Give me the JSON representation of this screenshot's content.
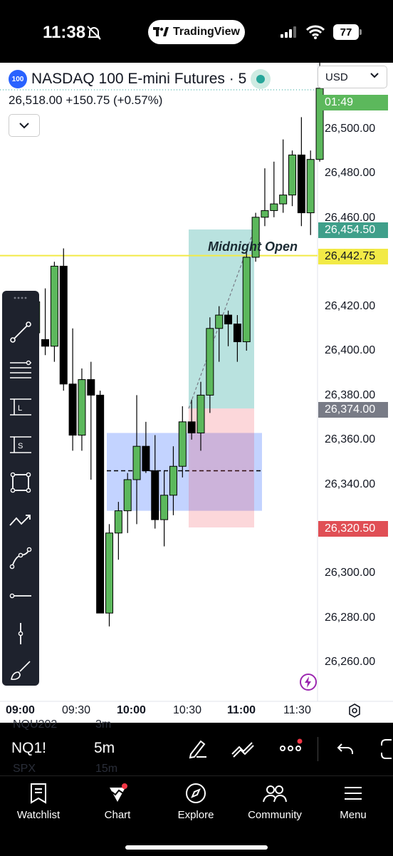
{
  "status_bar": {
    "time": "11:38",
    "app_pill": "TradingView",
    "battery": "77"
  },
  "chart_header": {
    "symbol_badge": "100",
    "title": "NASDAQ 100 E-mini Futures · 5",
    "quote": "26,518.00  +150.75 (+0.57%)",
    "currency": "USD"
  },
  "price_axis": {
    "ticks": [
      "26,500.00",
      "26,480.00",
      "26,460.00",
      "26,420.00",
      "26,400.00",
      "26,380.00",
      "26,360.00",
      "26,340.00",
      "26,300.00",
      "26,280.00",
      "26,260.00"
    ]
  },
  "price_tags": {
    "countdown": "01:49",
    "target": "26,454.50",
    "midnight_open": "26,442.75",
    "entry": "26,374.00",
    "stop": "26,320.50"
  },
  "annotations": {
    "midnight_open_label": "Midnight Open"
  },
  "time_axis": {
    "labels": [
      "09:00",
      "09:30",
      "10:00",
      "10:30",
      "11:00",
      "11:30"
    ]
  },
  "colors": {
    "up": "#5cb85c",
    "down": "#000000",
    "midnight_line": "#f2ea46",
    "target_tag": "#3f9f8a",
    "stop_tag": "#e04f55",
    "entry_tag": "#787b86",
    "countdown_tag": "#5cb85c"
  },
  "bottom_bar": {
    "symbol": "NQ1!",
    "interval": "5m",
    "ghost_symbols": [
      "NQU202",
      "SPX"
    ],
    "ghost_intervals": [
      "3m",
      "15m"
    ]
  },
  "nav": {
    "items": [
      {
        "label": "Watchlist",
        "icon": "watchlist-icon"
      },
      {
        "label": "Chart",
        "icon": "chart-icon"
      },
      {
        "label": "Explore",
        "icon": "compass-icon"
      },
      {
        "label": "Community",
        "icon": "community-icon"
      },
      {
        "label": "Menu",
        "icon": "menu-icon"
      }
    ]
  },
  "chart_data": {
    "type": "candlestick",
    "title": "NASDAQ 100 E-mini Futures · 5",
    "interval": "5m",
    "ylim": [
      26250,
      26525
    ],
    "candles": [
      {
        "o": 26420,
        "h": 26425,
        "l": 26408,
        "c": 26412
      },
      {
        "o": 26410,
        "h": 26418,
        "l": 26402,
        "c": 26405
      },
      {
        "o": 26408,
        "h": 26425,
        "l": 26400,
        "c": 26422
      },
      {
        "o": 26405,
        "h": 26428,
        "l": 26398,
        "c": 26402
      },
      {
        "o": 26402,
        "h": 26440,
        "l": 26395,
        "c": 26438
      },
      {
        "o": 26438,
        "h": 26446,
        "l": 26382,
        "c": 26385
      },
      {
        "o": 26385,
        "h": 26410,
        "l": 26355,
        "c": 26362
      },
      {
        "o": 26362,
        "h": 26392,
        "l": 26355,
        "c": 26387
      },
      {
        "o": 26387,
        "h": 26395,
        "l": 26342,
        "c": 26380
      },
      {
        "o": 26380,
        "h": 26382,
        "l": 26290,
        "c": 26282
      },
      {
        "o": 26282,
        "h": 26322,
        "l": 26276,
        "c": 26318
      },
      {
        "o": 26318,
        "h": 26332,
        "l": 26306,
        "c": 26328
      },
      {
        "o": 26328,
        "h": 26345,
        "l": 26318,
        "c": 26342
      },
      {
        "o": 26342,
        "h": 26380,
        "l": 26322,
        "c": 26357
      },
      {
        "o": 26357,
        "h": 26368,
        "l": 26345,
        "c": 26346
      },
      {
        "o": 26346,
        "h": 26362,
        "l": 26320,
        "c": 26324
      },
      {
        "o": 26324,
        "h": 26346,
        "l": 26312,
        "c": 26335
      },
      {
        "o": 26335,
        "h": 26357,
        "l": 26326,
        "c": 26348
      },
      {
        "o": 26348,
        "h": 26375,
        "l": 26343,
        "c": 26368
      },
      {
        "o": 26368,
        "h": 26378,
        "l": 26360,
        "c": 26363
      },
      {
        "o": 26363,
        "h": 26386,
        "l": 26355,
        "c": 26380
      },
      {
        "o": 26380,
        "h": 26415,
        "l": 26372,
        "c": 26410
      },
      {
        "o": 26410,
        "h": 26420,
        "l": 26395,
        "c": 26416
      },
      {
        "o": 26416,
        "h": 26418,
        "l": 26402,
        "c": 26412
      },
      {
        "o": 26412,
        "h": 26416,
        "l": 26395,
        "c": 26404
      },
      {
        "o": 26404,
        "h": 26446,
        "l": 26400,
        "c": 26442
      },
      {
        "o": 26442,
        "h": 26462,
        "l": 26440,
        "c": 26460
      },
      {
        "o": 26460,
        "h": 26482,
        "l": 26456,
        "c": 26463
      },
      {
        "o": 26463,
        "h": 26485,
        "l": 26460,
        "c": 26466
      },
      {
        "o": 26466,
        "h": 26495,
        "l": 26462,
        "c": 26470
      },
      {
        "o": 26470,
        "h": 26490,
        "l": 26465,
        "c": 26488
      },
      {
        "o": 26488,
        "h": 26505,
        "l": 26456,
        "c": 26462
      },
      {
        "o": 26462,
        "h": 26490,
        "l": 26452,
        "c": 26486
      },
      {
        "o": 26486,
        "h": 26530,
        "l": 26485,
        "c": 26518
      }
    ],
    "midnight_open": 26442.75,
    "long_position": {
      "entry": 26374.0,
      "target": 26454.5,
      "stop": 26320.5
    },
    "fvg_zone": {
      "top": 26363,
      "bottom": 26328,
      "mid": 26346
    }
  }
}
